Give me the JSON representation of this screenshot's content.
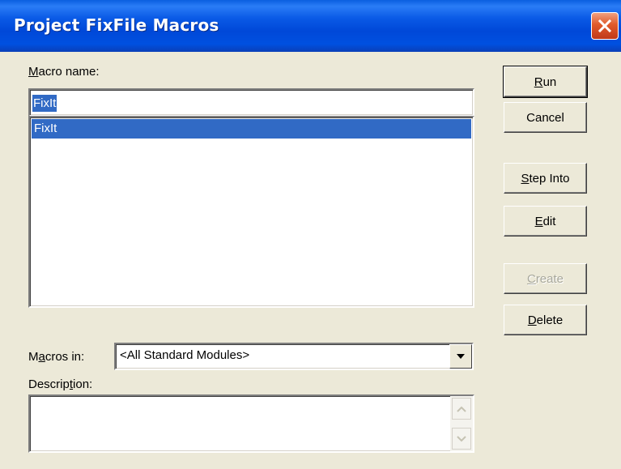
{
  "window": {
    "title": "Project FixFile Macros"
  },
  "labels": {
    "macro_name_prefix": "M",
    "macro_name_rest": "acro name:",
    "macros_in_prefix": "M",
    "macros_in_u": "a",
    "macros_in_rest": "cros in:",
    "description_pre": "Descrip",
    "description_u": "t",
    "description_rest": "ion:"
  },
  "macro_name_value": "FixIt",
  "macro_list": [
    {
      "name": "FixIt",
      "selected": true
    }
  ],
  "macros_in": {
    "selected": "<All Standard Modules>"
  },
  "description_value": "",
  "buttons": {
    "run": {
      "u": "R",
      "rest": "un"
    },
    "cancel": {
      "label": "Cancel"
    },
    "step_into": {
      "u": "S",
      "rest": "tep Into"
    },
    "edit": {
      "u": "E",
      "rest": "dit"
    },
    "create": {
      "u": "C",
      "rest": "reate",
      "enabled": false
    },
    "delete": {
      "u": "D",
      "rest": "elete"
    }
  },
  "colors": {
    "title_bar": "#0054e3",
    "selection": "#316ac5",
    "dialog_bg": "#ece9d8",
    "close_button": "#e05a2a"
  },
  "icons": {
    "close": "close-icon",
    "dropdown": "chevron-down-icon",
    "scroll_up": "arrow-up-icon",
    "scroll_down": "arrow-down-icon"
  }
}
